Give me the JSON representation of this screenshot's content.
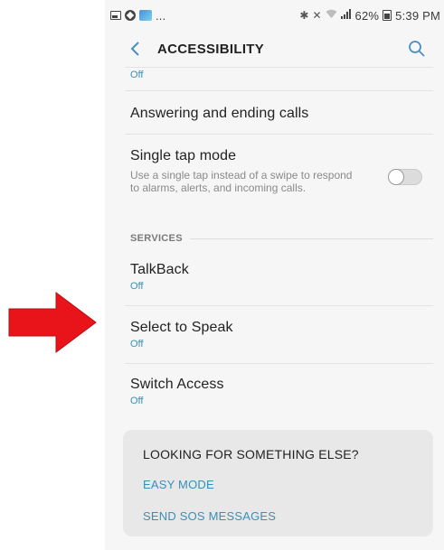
{
  "status_bar": {
    "left_dots": "...",
    "battery_percent": "62%",
    "time": "5:39 PM"
  },
  "header": {
    "title": "ACCESSIBILITY"
  },
  "top_item": {
    "subtitle": "Off"
  },
  "answering": {
    "title": "Answering and ending calls"
  },
  "single_tap": {
    "title": "Single tap mode",
    "description": "Use a single tap instead of a swipe to respond to alarms, alerts, and incoming calls.",
    "enabled": false
  },
  "services": {
    "header": "SERVICES",
    "items": [
      {
        "title": "TalkBack",
        "subtitle": "Off"
      },
      {
        "title": "Select to Speak",
        "subtitle": "Off"
      },
      {
        "title": "Switch Access",
        "subtitle": "Off"
      }
    ]
  },
  "card": {
    "title": "LOOKING FOR SOMETHING ELSE?",
    "links": [
      "EASY MODE",
      "SEND SOS MESSAGES"
    ]
  },
  "colors": {
    "accent": "#3a8fb7",
    "arrow": "#e8141a",
    "background": "#f6f6f6",
    "card": "#e8e8e8"
  },
  "icons": {
    "back": "chevron-left-icon",
    "search": "search-icon",
    "arrow": "red-arrow-icon"
  }
}
